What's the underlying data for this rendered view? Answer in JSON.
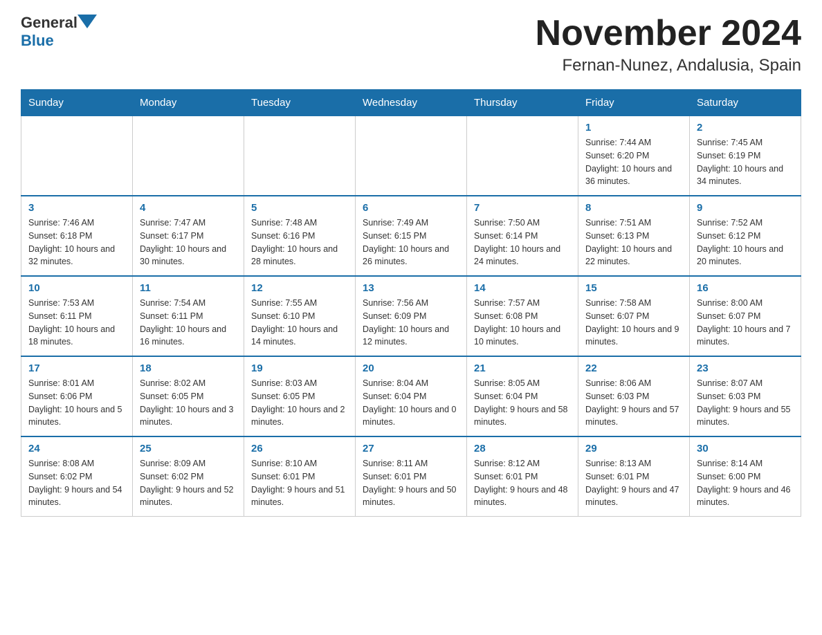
{
  "header": {
    "logo_general": "General",
    "logo_blue": "Blue",
    "title": "November 2024",
    "subtitle": "Fernan-Nunez, Andalusia, Spain"
  },
  "days_of_week": [
    "Sunday",
    "Monday",
    "Tuesday",
    "Wednesday",
    "Thursday",
    "Friday",
    "Saturday"
  ],
  "weeks": [
    [
      {
        "day": "",
        "info": ""
      },
      {
        "day": "",
        "info": ""
      },
      {
        "day": "",
        "info": ""
      },
      {
        "day": "",
        "info": ""
      },
      {
        "day": "",
        "info": ""
      },
      {
        "day": "1",
        "info": "Sunrise: 7:44 AM\nSunset: 6:20 PM\nDaylight: 10 hours and 36 minutes."
      },
      {
        "day": "2",
        "info": "Sunrise: 7:45 AM\nSunset: 6:19 PM\nDaylight: 10 hours and 34 minutes."
      }
    ],
    [
      {
        "day": "3",
        "info": "Sunrise: 7:46 AM\nSunset: 6:18 PM\nDaylight: 10 hours and 32 minutes."
      },
      {
        "day": "4",
        "info": "Sunrise: 7:47 AM\nSunset: 6:17 PM\nDaylight: 10 hours and 30 minutes."
      },
      {
        "day": "5",
        "info": "Sunrise: 7:48 AM\nSunset: 6:16 PM\nDaylight: 10 hours and 28 minutes."
      },
      {
        "day": "6",
        "info": "Sunrise: 7:49 AM\nSunset: 6:15 PM\nDaylight: 10 hours and 26 minutes."
      },
      {
        "day": "7",
        "info": "Sunrise: 7:50 AM\nSunset: 6:14 PM\nDaylight: 10 hours and 24 minutes."
      },
      {
        "day": "8",
        "info": "Sunrise: 7:51 AM\nSunset: 6:13 PM\nDaylight: 10 hours and 22 minutes."
      },
      {
        "day": "9",
        "info": "Sunrise: 7:52 AM\nSunset: 6:12 PM\nDaylight: 10 hours and 20 minutes."
      }
    ],
    [
      {
        "day": "10",
        "info": "Sunrise: 7:53 AM\nSunset: 6:11 PM\nDaylight: 10 hours and 18 minutes."
      },
      {
        "day": "11",
        "info": "Sunrise: 7:54 AM\nSunset: 6:11 PM\nDaylight: 10 hours and 16 minutes."
      },
      {
        "day": "12",
        "info": "Sunrise: 7:55 AM\nSunset: 6:10 PM\nDaylight: 10 hours and 14 minutes."
      },
      {
        "day": "13",
        "info": "Sunrise: 7:56 AM\nSunset: 6:09 PM\nDaylight: 10 hours and 12 minutes."
      },
      {
        "day": "14",
        "info": "Sunrise: 7:57 AM\nSunset: 6:08 PM\nDaylight: 10 hours and 10 minutes."
      },
      {
        "day": "15",
        "info": "Sunrise: 7:58 AM\nSunset: 6:07 PM\nDaylight: 10 hours and 9 minutes."
      },
      {
        "day": "16",
        "info": "Sunrise: 8:00 AM\nSunset: 6:07 PM\nDaylight: 10 hours and 7 minutes."
      }
    ],
    [
      {
        "day": "17",
        "info": "Sunrise: 8:01 AM\nSunset: 6:06 PM\nDaylight: 10 hours and 5 minutes."
      },
      {
        "day": "18",
        "info": "Sunrise: 8:02 AM\nSunset: 6:05 PM\nDaylight: 10 hours and 3 minutes."
      },
      {
        "day": "19",
        "info": "Sunrise: 8:03 AM\nSunset: 6:05 PM\nDaylight: 10 hours and 2 minutes."
      },
      {
        "day": "20",
        "info": "Sunrise: 8:04 AM\nSunset: 6:04 PM\nDaylight: 10 hours and 0 minutes."
      },
      {
        "day": "21",
        "info": "Sunrise: 8:05 AM\nSunset: 6:04 PM\nDaylight: 9 hours and 58 minutes."
      },
      {
        "day": "22",
        "info": "Sunrise: 8:06 AM\nSunset: 6:03 PM\nDaylight: 9 hours and 57 minutes."
      },
      {
        "day": "23",
        "info": "Sunrise: 8:07 AM\nSunset: 6:03 PM\nDaylight: 9 hours and 55 minutes."
      }
    ],
    [
      {
        "day": "24",
        "info": "Sunrise: 8:08 AM\nSunset: 6:02 PM\nDaylight: 9 hours and 54 minutes."
      },
      {
        "day": "25",
        "info": "Sunrise: 8:09 AM\nSunset: 6:02 PM\nDaylight: 9 hours and 52 minutes."
      },
      {
        "day": "26",
        "info": "Sunrise: 8:10 AM\nSunset: 6:01 PM\nDaylight: 9 hours and 51 minutes."
      },
      {
        "day": "27",
        "info": "Sunrise: 8:11 AM\nSunset: 6:01 PM\nDaylight: 9 hours and 50 minutes."
      },
      {
        "day": "28",
        "info": "Sunrise: 8:12 AM\nSunset: 6:01 PM\nDaylight: 9 hours and 48 minutes."
      },
      {
        "day": "29",
        "info": "Sunrise: 8:13 AM\nSunset: 6:01 PM\nDaylight: 9 hours and 47 minutes."
      },
      {
        "day": "30",
        "info": "Sunrise: 8:14 AM\nSunset: 6:00 PM\nDaylight: 9 hours and 46 minutes."
      }
    ]
  ]
}
